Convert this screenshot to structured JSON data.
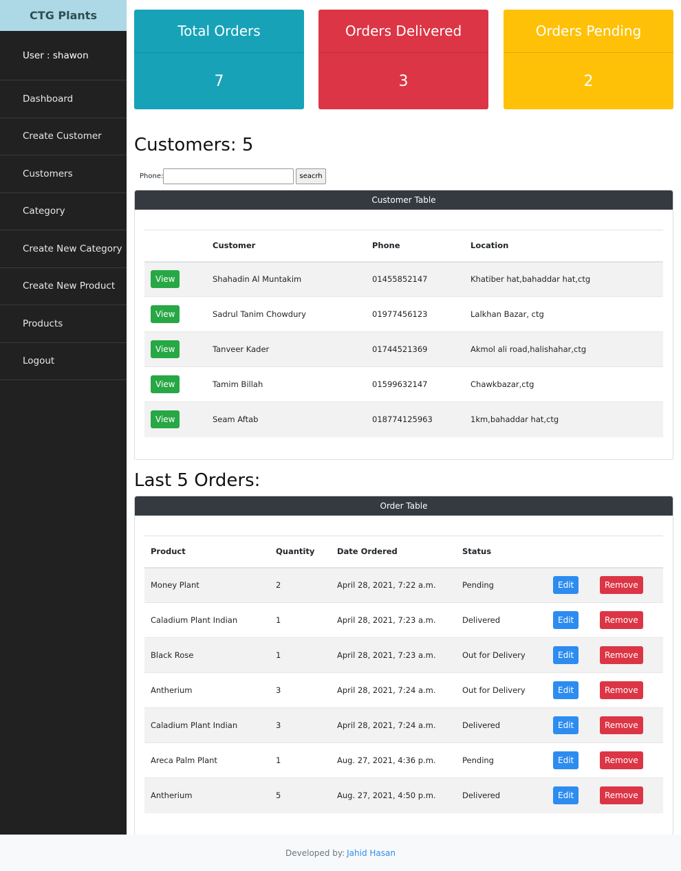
{
  "brand": "CTG Plants",
  "sidebar": {
    "user": "User : shawon",
    "items": [
      {
        "label": "Dashboard"
      },
      {
        "label": "Create Customer"
      },
      {
        "label": "Customers"
      },
      {
        "label": "Category"
      },
      {
        "label": "Create New Category"
      },
      {
        "label": "Create New Product"
      },
      {
        "label": "Products"
      },
      {
        "label": "Logout"
      }
    ]
  },
  "cards": [
    {
      "title": "Total Orders",
      "value": "7",
      "color": "#17a2b8"
    },
    {
      "title": "Orders Delivered",
      "value": "3",
      "color": "#dc3545"
    },
    {
      "title": "Orders Pending",
      "value": "2",
      "color": "#ffc107"
    }
  ],
  "customers": {
    "heading": "Customers: 5",
    "search_label": "Phone:",
    "search_value": "",
    "search_button": "seacrh",
    "table_title": "Customer Table",
    "columns": [
      "",
      "Customer",
      "Phone",
      "Location"
    ],
    "view_label": "View",
    "rows": [
      {
        "name": "Shahadin Al Muntakim",
        "phone": "01455852147",
        "location": "Khatiber hat,bahaddar hat,ctg"
      },
      {
        "name": "Sadrul Tanim Chowdury",
        "phone": "01977456123",
        "location": "Lalkhan Bazar, ctg"
      },
      {
        "name": "Tanveer Kader",
        "phone": "01744521369",
        "location": "Akmol ali road,halishahar,ctg"
      },
      {
        "name": "Tamim Billah",
        "phone": "01599632147",
        "location": "Chawkbazar,ctg"
      },
      {
        "name": "Seam Aftab",
        "phone": "018774125963",
        "location": "1km,bahaddar hat,ctg"
      }
    ]
  },
  "orders": {
    "heading": "Last 5 Orders:",
    "table_title": "Order Table",
    "columns": [
      "Product",
      "Quantity",
      "Date Ordered",
      "Status",
      "",
      ""
    ],
    "edit_label": "Edit",
    "remove_label": "Remove",
    "rows": [
      {
        "product": "Money Plant",
        "qty": "2",
        "date": "April 28, 2021, 7:22 a.m.",
        "status": "Pending"
      },
      {
        "product": "Caladium Plant Indian",
        "qty": "1",
        "date": "April 28, 2021, 7:23 a.m.",
        "status": "Delivered"
      },
      {
        "product": "Black Rose",
        "qty": "1",
        "date": "April 28, 2021, 7:23 a.m.",
        "status": "Out for Delivery"
      },
      {
        "product": "Antherium",
        "qty": "3",
        "date": "April 28, 2021, 7:24 a.m.",
        "status": "Out for Delivery"
      },
      {
        "product": "Caladium Plant Indian",
        "qty": "3",
        "date": "April 28, 2021, 7:24 a.m.",
        "status": "Delivered"
      },
      {
        "product": "Areca Palm Plant",
        "qty": "1",
        "date": "Aug. 27, 2021, 4:36 p.m.",
        "status": "Pending"
      },
      {
        "product": "Antherium",
        "qty": "5",
        "date": "Aug. 27, 2021, 4:50 p.m.",
        "status": "Delivered"
      }
    ]
  },
  "footer": {
    "text": "Developed by:",
    "author": "Jahid Hasan"
  }
}
